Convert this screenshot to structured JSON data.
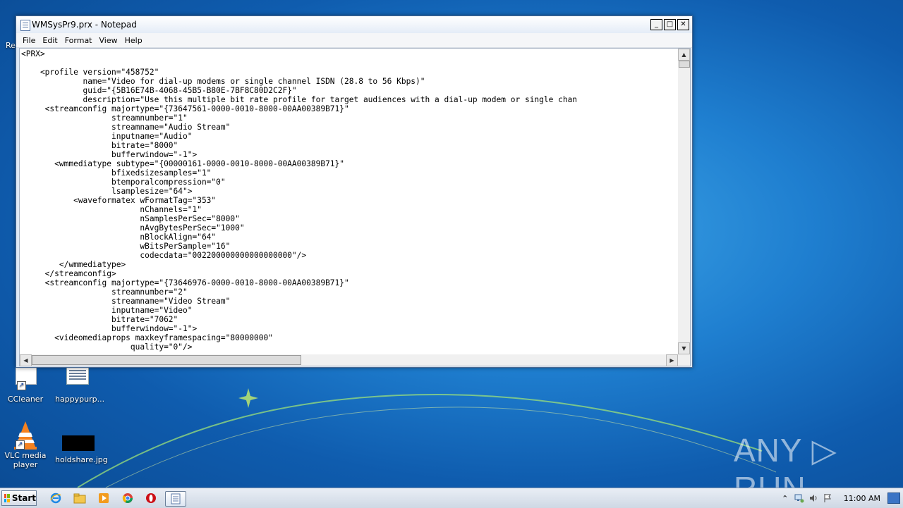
{
  "window": {
    "title": "WMSysPr9.prx - Notepad",
    "controls": {
      "minimize": "_",
      "maximize": "□",
      "close": "✕"
    }
  },
  "menu": [
    "File",
    "Edit",
    "Format",
    "View",
    "Help"
  ],
  "editor_text": "<PRX>\n\n    <profile version=\"458752\"\n             name=\"Video for dial-up modems or single channel ISDN (28.8 to 56 Kbps)\"\n             guid=\"{5B16E74B-4068-45B5-B80E-7BF8C80D2C2F}\"\n             description=\"Use this multiple bit rate profile for target audiences with a dial-up modem or single chan\n     <streamconfig majortype=\"{73647561-0000-0010-8000-00AA00389B71}\"\n                   streamnumber=\"1\"\n                   streamname=\"Audio Stream\"\n                   inputname=\"Audio\"\n                   bitrate=\"8000\"\n                   bufferwindow=\"-1\">\n       <wmmediatype subtype=\"{00000161-0000-0010-8000-00AA00389B71}\"\n                   bfixedsizesamples=\"1\"\n                   btemporalcompression=\"0\"\n                   lsamplesize=\"64\">\n           <waveformatex wFormatTag=\"353\"\n                         nChannels=\"1\"\n                         nSamplesPerSec=\"8000\"\n                         nAvgBytesPerSec=\"1000\"\n                         nBlockAlign=\"64\"\n                         wBitsPerSample=\"16\"\n                         codecdata=\"002200000000000000000\"/>\n        </wmmediatype>\n     </streamconfig>\n     <streamconfig majortype=\"{73646976-0000-0010-8000-00AA00389B71}\"\n                   streamnumber=\"2\"\n                   streamname=\"Video Stream\"\n                   inputname=\"Video\"\n                   bitrate=\"7062\"\n                   bufferwindow=\"-1\">\n       <videomediaprops maxkeyframespacing=\"80000000\"\n                       quality=\"0\"/>",
  "desktop_icons": [
    {
      "label": "CCleaner",
      "icon": "ccleaner-icon"
    },
    {
      "label": "happypurp...",
      "icon": "text-document-icon"
    },
    {
      "label": "VLC media player",
      "icon": "vlc-icon"
    },
    {
      "label": "holdshare.jpg",
      "icon": "image-file-icon"
    }
  ],
  "desktop_edge_labels": [
    "Re"
  ],
  "watermark": "ANY ▷ RUN",
  "taskbar": {
    "start_label": "Start",
    "pinned": [
      "internet-explorer-icon",
      "explorer-folder-icon",
      "media-player-icon",
      "chrome-icon",
      "opera-icon",
      "notepad-icon"
    ],
    "clock": "11:00 AM"
  },
  "colors": {
    "desktop": "#1f7fd0",
    "titlebar": "#e4ecf7",
    "taskbar": "#dbe3ee"
  }
}
